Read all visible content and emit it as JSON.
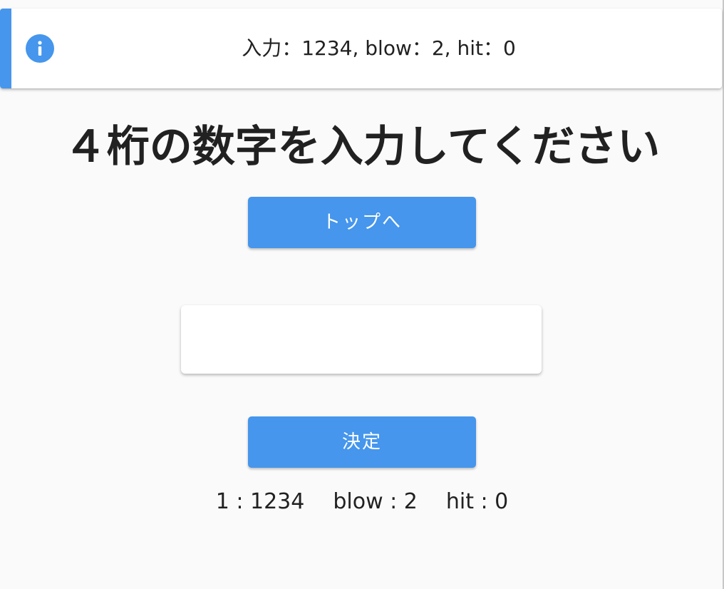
{
  "notification": {
    "icon": "info-icon",
    "message": "入力：1234, blow：2, hit：0",
    "accent_color": "#4596ec"
  },
  "title": "４桁の数字を入力してください",
  "buttons": {
    "top_label": "トップへ",
    "submit_label": "決定",
    "color": "#4596ec"
  },
  "input": {
    "value": "",
    "placeholder": ""
  },
  "history": [
    {
      "attempt": "1 : 1234",
      "blow": "blow : 2",
      "hit": "hit : 0"
    }
  ]
}
